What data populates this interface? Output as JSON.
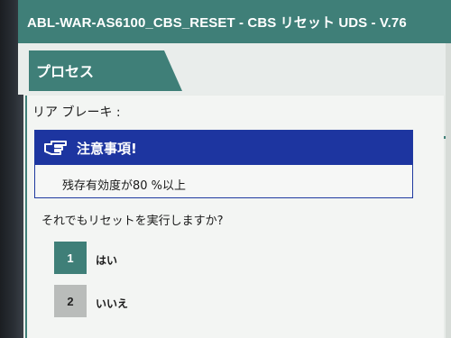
{
  "window": {
    "title": "ABL-WAR-AS6100_CBS_RESET - CBS リセット UDS - V.76"
  },
  "tabs": [
    {
      "label": "プロセス",
      "active": true
    }
  ],
  "content": {
    "heading": "リア ブレーキ :",
    "notice": {
      "icon": "pointing-hand-icon",
      "title": "注意事項!",
      "text": "残存有効度が80 %以上"
    },
    "question": "それでもリセットを実行しますか?",
    "choices": [
      {
        "number": "1",
        "label": "はい"
      },
      {
        "number": "2",
        "label": "いいえ"
      }
    ]
  },
  "colors": {
    "accent": "#3f7f78",
    "notice_header": "#1d35a0",
    "choice_inactive": "#b9bcba"
  }
}
